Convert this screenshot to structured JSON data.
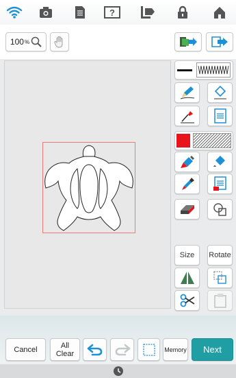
{
  "toolbar": {
    "zoom_value": "100",
    "zoom_unit": "%"
  },
  "panel": {
    "size_label": "Size",
    "rotate_label": "Rotate"
  },
  "bottom": {
    "cancel_label": "Cancel",
    "allclear_line1": "All",
    "allclear_line2": "Clear",
    "memory_label": "Memory",
    "next_label": "Next"
  },
  "colors": {
    "accent": "#1f9ea3",
    "fill_color": "#e8141b",
    "selection": "#f07a7a"
  },
  "icons": [
    "wifi-icon",
    "camera-icon",
    "document-icon",
    "help-icon",
    "import-export-icon",
    "lock-icon",
    "home-icon"
  ]
}
